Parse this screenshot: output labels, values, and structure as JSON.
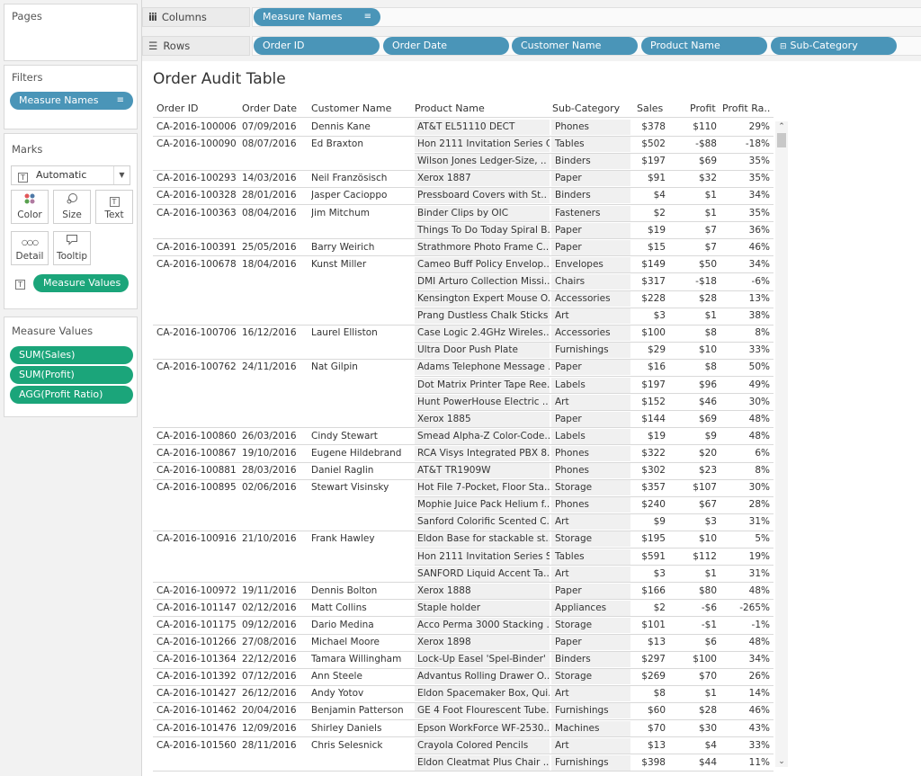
{
  "panels": {
    "pages_title": "Pages",
    "filters_title": "Filters",
    "filter_pill": "Measure Names",
    "marks_title": "Marks",
    "marks_type": "Automatic",
    "marks_buttons": [
      "Color",
      "Size",
      "Text",
      "Detail",
      "Tooltip"
    ],
    "marks_text_pill": "Measure Values",
    "measure_values_title": "Measure Values",
    "measure_values": [
      "SUM(Sales)",
      "SUM(Profit)",
      "AGG(Profit Ratio)"
    ]
  },
  "shelves": {
    "columns_label": "Columns",
    "rows_label": "Rows",
    "columns_pill": "Measure Names",
    "rows_pills": [
      "Order ID",
      "Order Date",
      "Customer Name",
      "Product Name",
      "Sub-Category"
    ]
  },
  "viz": {
    "title": "Order Audit Table",
    "headers": [
      "Order ID",
      "Order Date",
      "Customer Name",
      "Product Name",
      "Sub-Category",
      "Sales",
      "Profit",
      "Profit Ra.."
    ],
    "rows": [
      [
        "CA-2016-100006",
        "07/09/2016",
        "Dennis Kane",
        "AT&T EL51110 DECT",
        "Phones",
        "$378",
        "$110",
        "29%"
      ],
      [
        "CA-2016-100090",
        "08/07/2016",
        "Ed Braxton",
        "Hon 2111 Invitation Series C..",
        "Tables",
        "$502",
        "-$88",
        "-18%"
      ],
      [
        "",
        "",
        "",
        "Wilson Jones Ledger-Size, ..",
        "Binders",
        "$197",
        "$69",
        "35%"
      ],
      [
        "CA-2016-100293",
        "14/03/2016",
        "Neil Französisch",
        "Xerox 1887",
        "Paper",
        "$91",
        "$32",
        "35%"
      ],
      [
        "CA-2016-100328",
        "28/01/2016",
        "Jasper Cacioppo",
        "Pressboard Covers with St..",
        "Binders",
        "$4",
        "$1",
        "34%"
      ],
      [
        "CA-2016-100363",
        "08/04/2016",
        "Jim Mitchum",
        "Binder Clips by OIC",
        "Fasteners",
        "$2",
        "$1",
        "35%"
      ],
      [
        "",
        "",
        "",
        "Things To Do Today Spiral B..",
        "Paper",
        "$19",
        "$7",
        "36%"
      ],
      [
        "CA-2016-100391",
        "25/05/2016",
        "Barry Weirich",
        "Strathmore Photo Frame C..",
        "Paper",
        "$15",
        "$7",
        "46%"
      ],
      [
        "CA-2016-100678",
        "18/04/2016",
        "Kunst Miller",
        "Cameo Buff Policy Envelop..",
        "Envelopes",
        "$149",
        "$50",
        "34%"
      ],
      [
        "",
        "",
        "",
        "DMI Arturo Collection Missi..",
        "Chairs",
        "$317",
        "-$18",
        "-6%"
      ],
      [
        "",
        "",
        "",
        "Kensington Expert Mouse O..",
        "Accessories",
        "$228",
        "$28",
        "13%"
      ],
      [
        "",
        "",
        "",
        "Prang Dustless Chalk Sticks",
        "Art",
        "$3",
        "$1",
        "38%"
      ],
      [
        "CA-2016-100706",
        "16/12/2016",
        "Laurel Elliston",
        "Case Logic 2.4GHz Wireles..",
        "Accessories",
        "$100",
        "$8",
        "8%"
      ],
      [
        "",
        "",
        "",
        "Ultra Door Push Plate",
        "Furnishings",
        "$29",
        "$10",
        "33%"
      ],
      [
        "CA-2016-100762",
        "24/11/2016",
        "Nat Gilpin",
        "Adams Telephone Message ..",
        "Paper",
        "$16",
        "$8",
        "50%"
      ],
      [
        "",
        "",
        "",
        "Dot Matrix Printer Tape Ree..",
        "Labels",
        "$197",
        "$96",
        "49%"
      ],
      [
        "",
        "",
        "",
        "Hunt PowerHouse Electric ..",
        "Art",
        "$152",
        "$46",
        "30%"
      ],
      [
        "",
        "",
        "",
        "Xerox 1885",
        "Paper",
        "$144",
        "$69",
        "48%"
      ],
      [
        "CA-2016-100860",
        "26/03/2016",
        "Cindy Stewart",
        "Smead Alpha-Z Color-Code..",
        "Labels",
        "$19",
        "$9",
        "48%"
      ],
      [
        "CA-2016-100867",
        "19/10/2016",
        "Eugene Hildebrand",
        "RCA Visys Integrated PBX 8..",
        "Phones",
        "$322",
        "$20",
        "6%"
      ],
      [
        "CA-2016-100881",
        "28/03/2016",
        "Daniel Raglin",
        "AT&T TR1909W",
        "Phones",
        "$302",
        "$23",
        "8%"
      ],
      [
        "CA-2016-100895",
        "02/06/2016",
        "Stewart Visinsky",
        "Hot File 7-Pocket, Floor Sta..",
        "Storage",
        "$357",
        "$107",
        "30%"
      ],
      [
        "",
        "",
        "",
        "Mophie Juice Pack Helium f..",
        "Phones",
        "$240",
        "$67",
        "28%"
      ],
      [
        "",
        "",
        "",
        "Sanford Colorific Scented C..",
        "Art",
        "$9",
        "$3",
        "31%"
      ],
      [
        "CA-2016-100916",
        "21/10/2016",
        "Frank Hawley",
        "Eldon Base for stackable st..",
        "Storage",
        "$195",
        "$10",
        "5%"
      ],
      [
        "",
        "",
        "",
        "Hon 2111 Invitation Series St..",
        "Tables",
        "$591",
        "$112",
        "19%"
      ],
      [
        "",
        "",
        "",
        "SANFORD Liquid Accent Ta..",
        "Art",
        "$3",
        "$1",
        "31%"
      ],
      [
        "CA-2016-100972",
        "19/11/2016",
        "Dennis Bolton",
        "Xerox 1888",
        "Paper",
        "$166",
        "$80",
        "48%"
      ],
      [
        "CA-2016-101147",
        "02/12/2016",
        "Matt Collins",
        "Staple holder",
        "Appliances",
        "$2",
        "-$6",
        "-265%"
      ],
      [
        "CA-2016-101175",
        "09/12/2016",
        "Dario Medina",
        "Acco Perma 3000 Stacking ..",
        "Storage",
        "$101",
        "-$1",
        "-1%"
      ],
      [
        "CA-2016-101266",
        "27/08/2016",
        "Michael Moore",
        "Xerox 1898",
        "Paper",
        "$13",
        "$6",
        "48%"
      ],
      [
        "CA-2016-101364",
        "22/12/2016",
        "Tamara Willingham",
        "Lock-Up Easel 'Spel-Binder'",
        "Binders",
        "$297",
        "$100",
        "34%"
      ],
      [
        "CA-2016-101392",
        "07/12/2016",
        "Ann Steele",
        "Advantus Rolling Drawer O..",
        "Storage",
        "$269",
        "$70",
        "26%"
      ],
      [
        "CA-2016-101427",
        "26/12/2016",
        "Andy Yotov",
        "Eldon Spacemaker Box, Qui..",
        "Art",
        "$8",
        "$1",
        "14%"
      ],
      [
        "CA-2016-101462",
        "20/04/2016",
        "Benjamin Patterson",
        "GE 4 Foot Flourescent Tube..",
        "Furnishings",
        "$60",
        "$28",
        "46%"
      ],
      [
        "CA-2016-101476",
        "12/09/2016",
        "Shirley Daniels",
        "Epson WorkForce WF-2530..",
        "Machines",
        "$70",
        "$30",
        "43%"
      ],
      [
        "CA-2016-101560",
        "28/11/2016",
        "Chris Selesnick",
        "Crayola Colored Pencils",
        "Art",
        "$13",
        "$4",
        "33%"
      ],
      [
        "",
        "",
        "",
        "Eldon Cleatmat Plus Chair ..",
        "Furnishings",
        "$398",
        "$44",
        "11%"
      ]
    ]
  }
}
